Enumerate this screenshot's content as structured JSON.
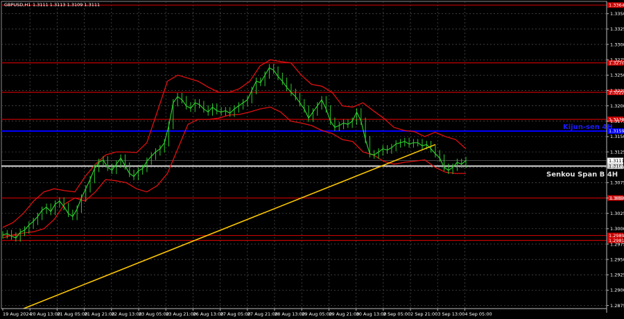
{
  "header": {
    "symbol_tf": "GBPUSD,H1",
    "ohlc": "1.3111 1.3113 1.3109 1.3111"
  },
  "chart_data": {
    "type": "line",
    "title": "GBPUSD,H1",
    "ylim": [
      1.287,
      1.337
    ],
    "y_ticks": [
      "1.3350",
      "1.3325",
      "1.3300",
      "1.3275",
      "1.3250",
      "1.3225",
      "1.3200",
      "1.3175",
      "1.3150",
      "1.3125",
      "1.3100",
      "1.3075",
      "1.3050",
      "1.3025",
      "1.3000",
      "1.2975",
      "1.2950",
      "1.2925",
      "1.2900",
      "1.2875"
    ],
    "x_tick_labels": [
      "19 Aug 2024",
      "20 Aug 13:00",
      "21 Aug 05:00",
      "21 Aug 21:00",
      "22 Aug 13:00",
      "23 Aug 05:00",
      "23 Aug 21:00",
      "26 Aug 13:00",
      "27 Aug 05:00",
      "27 Aug 21:00",
      "28 Aug 13:00",
      "29 Aug 05:00",
      "29 Aug 21:00",
      "30 Aug 13:00",
      "2 Sep 05:00",
      "2 Sep 21:00",
      "3 Sep 13:00",
      "4 Sep 05:00"
    ],
    "current_price": "1.3111",
    "red_levels": [
      {
        "value": 1.3364,
        "tag": "1.3364"
      },
      {
        "value": 1.327,
        "tag": "1.3270"
      },
      {
        "value": 1.3222,
        "tag": "1.3222"
      },
      {
        "value": 1.3178,
        "tag": "1.3178"
      },
      {
        "value": 1.305,
        "tag": "1.3050"
      },
      {
        "value": 1.2989,
        "tag": "1.2989"
      },
      {
        "value": 1.2981,
        "tag": "1.2981"
      }
    ],
    "kijun_sen": {
      "name": "Kijun-sen 4H",
      "value": 1.3159,
      "tag": "1.3159"
    },
    "senkou_span_b": {
      "name": "Senkou Span B 4H",
      "value": 1.3102,
      "tag": "1.3102"
    },
    "trend_line": {
      "start": [
        0,
        1.287
      ],
      "end": [
        118,
        1.3137
      ]
    },
    "price_series": [
      1.299,
      1.2992,
      1.2988,
      1.2985,
      1.2994,
      1.2998,
      1.3006,
      1.3012,
      1.302,
      1.303,
      1.3035,
      1.3028,
      1.304,
      1.3045,
      1.3036,
      1.3025,
      1.302,
      1.3032,
      1.305,
      1.3065,
      1.308,
      1.3098,
      1.3108,
      1.3112,
      1.31,
      1.3095,
      1.3105,
      1.3115,
      1.3102,
      1.309,
      1.3085,
      1.3094,
      1.3098,
      1.311,
      1.3118,
      1.3125,
      1.313,
      1.314,
      1.3168,
      1.3205,
      1.3215,
      1.321,
      1.32,
      1.3196,
      1.3205,
      1.3202,
      1.3195,
      1.319,
      1.3198,
      1.3192,
      1.319,
      1.3192,
      1.3188,
      1.3195,
      1.32,
      1.3205,
      1.321,
      1.3225,
      1.324,
      1.3238,
      1.325,
      1.3262,
      1.3258,
      1.3248,
      1.324,
      1.323,
      1.3222,
      1.3215,
      1.3205,
      1.3195,
      1.318,
      1.319,
      1.32,
      1.321,
      1.3195,
      1.3175,
      1.3165,
      1.3168,
      1.3172,
      1.317,
      1.3175,
      1.319,
      1.3175,
      1.3145,
      1.3122,
      1.312,
      1.3125,
      1.313,
      1.3128,
      1.3132,
      1.3138,
      1.314,
      1.3142,
      1.3138,
      1.314,
      1.314,
      1.3135,
      1.3137,
      1.313,
      1.3122,
      1.3115,
      1.31,
      1.3095,
      1.31,
      1.3108,
      1.3105,
      1.3111
    ],
    "upper_band": [
      1.3002,
      1.301,
      1.3025,
      1.3045,
      1.306,
      1.3065,
      1.3062,
      1.306,
      1.3085,
      1.3105,
      1.312,
      1.3125,
      1.3125,
      1.3124,
      1.314,
      1.319,
      1.324,
      1.325,
      1.3245,
      1.324,
      1.323,
      1.3222,
      1.3222,
      1.3228,
      1.324,
      1.3265,
      1.3275,
      1.3272,
      1.327,
      1.325,
      1.3235,
      1.3232,
      1.3222,
      1.32,
      1.3198,
      1.3205,
      1.3192,
      1.318,
      1.3165,
      1.316,
      1.3158,
      1.315,
      1.3157,
      1.315,
      1.3145,
      1.313
    ],
    "lower_band": [
      1.2985,
      1.299,
      1.2993,
      1.2995,
      1.3,
      1.3015,
      1.304,
      1.305,
      1.3045,
      1.306,
      1.308,
      1.3078,
      1.3075,
      1.3065,
      1.306,
      1.307,
      1.309,
      1.313,
      1.317,
      1.3178,
      1.3178,
      1.318,
      1.3185,
      1.3186,
      1.319,
      1.3195,
      1.3198,
      1.319,
      1.3175,
      1.3172,
      1.3168,
      1.316,
      1.3155,
      1.3145,
      1.3142,
      1.3125,
      1.312,
      1.311,
      1.3105,
      1.3108,
      1.311,
      1.3112,
      1.31,
      1.3092,
      1.309,
      1.309
    ]
  }
}
